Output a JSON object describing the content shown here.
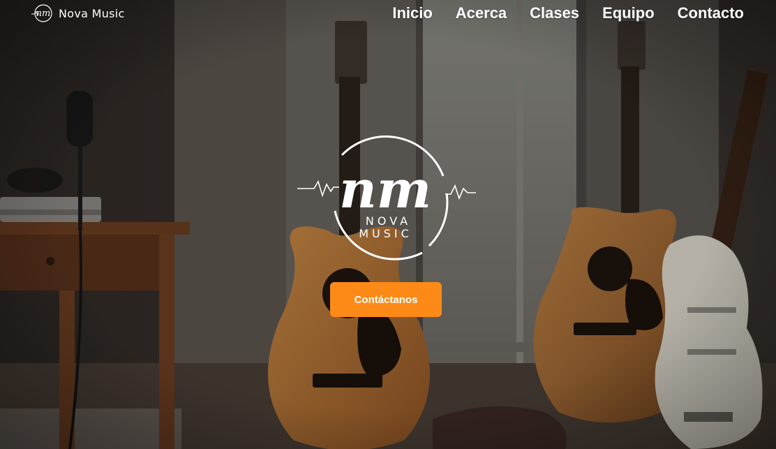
{
  "brand": {
    "logo_icon": "nova-music-logo-icon",
    "name": "Nova Music"
  },
  "nav": {
    "items": [
      {
        "label": "Inicio"
      },
      {
        "label": "Acerca"
      },
      {
        "label": "Clases"
      },
      {
        "label": "Equipo"
      },
      {
        "label": "Contacto"
      }
    ]
  },
  "hero": {
    "logo_monogram": "nm",
    "logo_line_1": "NOVA",
    "logo_line_2": "MUSIC",
    "cta_label": "Contáctanos"
  },
  "colors": {
    "accent": "#fd8a16",
    "text": "#ffffff"
  }
}
